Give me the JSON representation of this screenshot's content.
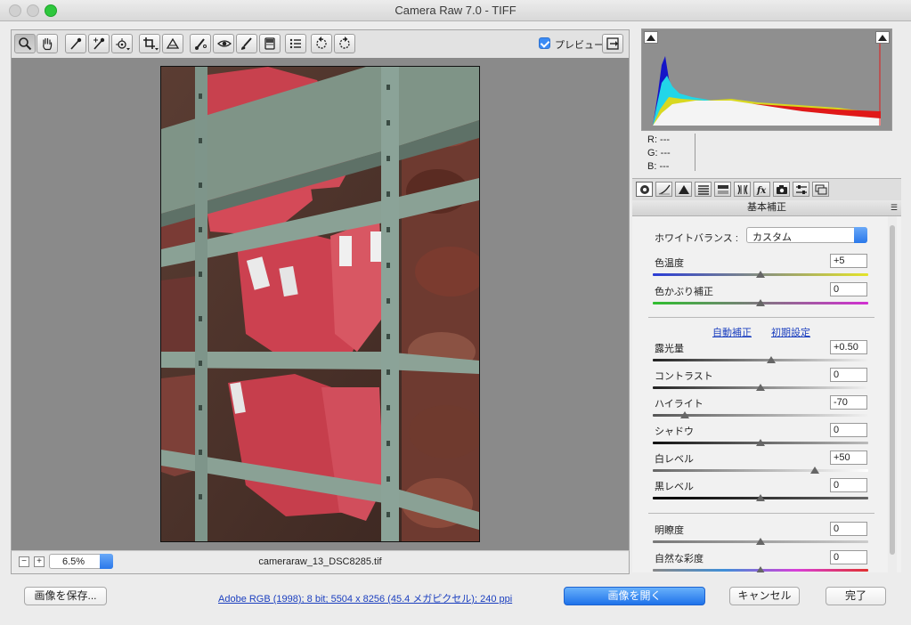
{
  "window": {
    "title": "Camera Raw 7.0  -  TIFF"
  },
  "toolbar": {
    "tools": [
      {
        "name": "zoom-tool"
      },
      {
        "name": "hand-tool"
      },
      {
        "name": "white-balance-tool"
      },
      {
        "name": "color-sampler-tool"
      },
      {
        "name": "targeted-adjustment-tool"
      },
      {
        "name": "crop-tool"
      },
      {
        "name": "straighten-tool"
      },
      {
        "name": "spot-removal-tool"
      },
      {
        "name": "red-eye-removal-tool"
      },
      {
        "name": "adjustment-brush-tool"
      },
      {
        "name": "graduated-filter-tool"
      },
      {
        "name": "preferences-tool"
      },
      {
        "name": "rotate-ccw-tool"
      },
      {
        "name": "rotate-cw-tool"
      }
    ],
    "preview_label": "プレビュー",
    "preview_checked": true
  },
  "status": {
    "zoom": "6.5%",
    "filename": "cameraraw_13_DSC8285.tif"
  },
  "readout": {
    "r": "R:   ---",
    "g": "G:   ---",
    "b": "B:   ---"
  },
  "panel": {
    "title": "基本補正",
    "white_balance_label": "ホワイトバランス :",
    "white_balance_value": "カスタム",
    "auto_link": "自動補正",
    "default_link": "初期設定",
    "sliders": [
      {
        "label": "色温度",
        "value": "+5",
        "pos": 0.5
      },
      {
        "label": "色かぶり補正",
        "value": "0",
        "pos": 0.5
      },
      {
        "label": "露光量",
        "value": "+0.50",
        "pos": 0.55
      },
      {
        "label": "コントラスト",
        "value": "0",
        "pos": 0.5
      },
      {
        "label": "ハイライト",
        "value": "-70",
        "pos": 0.15
      },
      {
        "label": "シャドウ",
        "value": "0",
        "pos": 0.5
      },
      {
        "label": "白レベル",
        "value": "+50",
        "pos": 0.75
      },
      {
        "label": "黒レベル",
        "value": "0",
        "pos": 0.5
      },
      {
        "label": "明瞭度",
        "value": "0",
        "pos": 0.5
      },
      {
        "label": "自然な彩度",
        "value": "0",
        "pos": 0.5
      }
    ]
  },
  "footer": {
    "save_label": "画像を保存...",
    "info": "Adobe RGB (1998); 8 bit; 5504 x 8256 (45.4 メガピクセル); 240 ppi",
    "open_label": "画像を開く",
    "cancel_label": "キャンセル",
    "done_label": "完了"
  },
  "colors": {
    "accent": "#2a78ea",
    "link": "#1b3fbf"
  }
}
